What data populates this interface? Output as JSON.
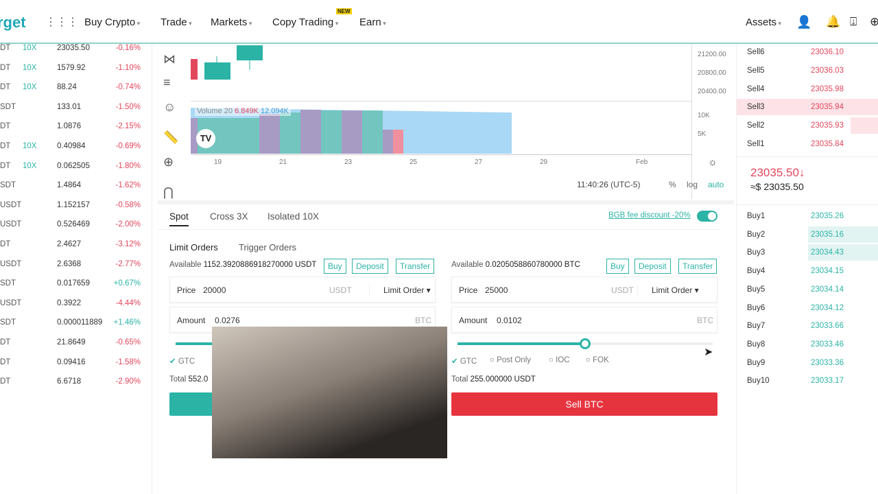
{
  "nav": {
    "logo": "rget",
    "menu": [
      "Buy Crypto",
      "Trade",
      "Markets",
      "Copy Trading",
      "Earn"
    ],
    "new_badge": "NEW",
    "assets": "Assets"
  },
  "markets": [
    {
      "pair": "DT",
      "leverage": "10X",
      "price": "23035.50",
      "change": "-0.16%"
    },
    {
      "pair": "DT",
      "leverage": "10X",
      "price": "1579.92",
      "change": "-1.10%"
    },
    {
      "pair": "DT",
      "leverage": "10X",
      "price": "88.24",
      "change": "-0.74%"
    },
    {
      "pair": "SDT",
      "leverage": "",
      "price": "133.01",
      "change": "-1.50%"
    },
    {
      "pair": "DT",
      "leverage": "",
      "price": "1.0876",
      "change": "-2.15%"
    },
    {
      "pair": "DT",
      "leverage": "10X",
      "price": "0.40984",
      "change": "-0.69%"
    },
    {
      "pair": "DT",
      "leverage": "10X",
      "price": "0.062505",
      "change": "-1.80%"
    },
    {
      "pair": "SDT",
      "leverage": "",
      "price": "1.4864",
      "change": "-1.62%"
    },
    {
      "pair": "USDT",
      "leverage": "",
      "price": "1.152157",
      "change": "-0.58%"
    },
    {
      "pair": "USDT",
      "leverage": "",
      "price": "0.526469",
      "change": "-2.00%"
    },
    {
      "pair": "DT",
      "leverage": "",
      "price": "2.4627",
      "change": "-3.12%"
    },
    {
      "pair": "USDT",
      "leverage": "",
      "price": "2.6368",
      "change": "-2.77%"
    },
    {
      "pair": "SDT",
      "leverage": "",
      "price": "0.017659",
      "change": "+0.67%"
    },
    {
      "pair": "USDT",
      "leverage": "",
      "price": "0.3922",
      "change": "-4.44%"
    },
    {
      "pair": "SDT",
      "leverage": "",
      "price": "0.000011889",
      "change": "+1.46%"
    },
    {
      "pair": "DT",
      "leverage": "",
      "price": "21.8649",
      "change": "-0.65%"
    },
    {
      "pair": "DT",
      "leverage": "",
      "price": "0.09416",
      "change": "-1.58%"
    },
    {
      "pair": "DT",
      "leverage": "",
      "price": "6.6718",
      "change": "-2.90%"
    }
  ],
  "chart": {
    "price_ticks": [
      "21200.00",
      "20800.00",
      "20400.00"
    ],
    "volume_ticks": [
      "10K",
      "5K"
    ],
    "date_ticks": [
      "19",
      "21",
      "23",
      "25",
      "27",
      "29",
      "Feb"
    ],
    "volume_label": "Volume 20",
    "volume_value": "6.849K",
    "volume_ma": "12.094K",
    "time": "11:40:26 (UTC-5)",
    "pct": "%",
    "log": "log",
    "auto": "auto",
    "colors": {
      "up": "#2bb3a6",
      "down": "#e2465c"
    }
  },
  "trade": {
    "tabs": [
      "Spot",
      "Cross 3X",
      "Isolated 10X"
    ],
    "fee_discount": "BGB fee discount -20%",
    "fee_toggle_on": true,
    "order_tabs": [
      "Limit Orders",
      "Trigger Orders"
    ],
    "buy": {
      "available_label": "Available",
      "available": "1152.3920886918270000 USDT",
      "price_label": "Price",
      "price": "20000",
      "price_unit": "USDT",
      "order_type": "Limit Order",
      "amount_label": "Amount",
      "amount": "0.0276",
      "amount_unit": "BTC",
      "total_label": "Total",
      "total": "552.0"
    },
    "sell": {
      "available_label": "Available",
      "available": "0.0205058860780000 BTC",
      "price_label": "Price",
      "price": "25000",
      "price_unit": "USDT",
      "order_type": "Limit Order",
      "amount_label": "Amount",
      "amount": "0.0102",
      "amount_unit": "BTC",
      "total_label": "Total",
      "total": "255.000000 USDT",
      "slider_percent": 50,
      "submit": "Sell BTC"
    },
    "actions": [
      "Buy",
      "Deposit",
      "Transfer"
    ],
    "tif": [
      "GTC",
      "Post Only",
      "IOC",
      "FOK"
    ]
  },
  "orderbook": {
    "sells": [
      {
        "label": "Sell6",
        "price": "23036.10"
      },
      {
        "label": "Sell5",
        "price": "23036.03"
      },
      {
        "label": "Sell4",
        "price": "23035.98"
      },
      {
        "label": "Sell3",
        "price": "23035.94"
      },
      {
        "label": "Sell2",
        "price": "23035.93"
      },
      {
        "label": "Sell1",
        "price": "23035.84"
      }
    ],
    "last_price": "23035.50↓",
    "last_usd": "≈$ 23035.50",
    "buys": [
      {
        "label": "Buy1",
        "price": "23035.26"
      },
      {
        "label": "Buy2",
        "price": "23035.16"
      },
      {
        "label": "Buy3",
        "price": "23034.43"
      },
      {
        "label": "Buy4",
        "price": "23034.15"
      },
      {
        "label": "Buy5",
        "price": "23034.14"
      },
      {
        "label": "Buy6",
        "price": "23034.12"
      },
      {
        "label": "Buy7",
        "price": "23033.66"
      },
      {
        "label": "Buy8",
        "price": "23033.46"
      },
      {
        "label": "Buy9",
        "price": "23033.36"
      },
      {
        "label": "Buy10",
        "price": "23033.17"
      }
    ]
  }
}
